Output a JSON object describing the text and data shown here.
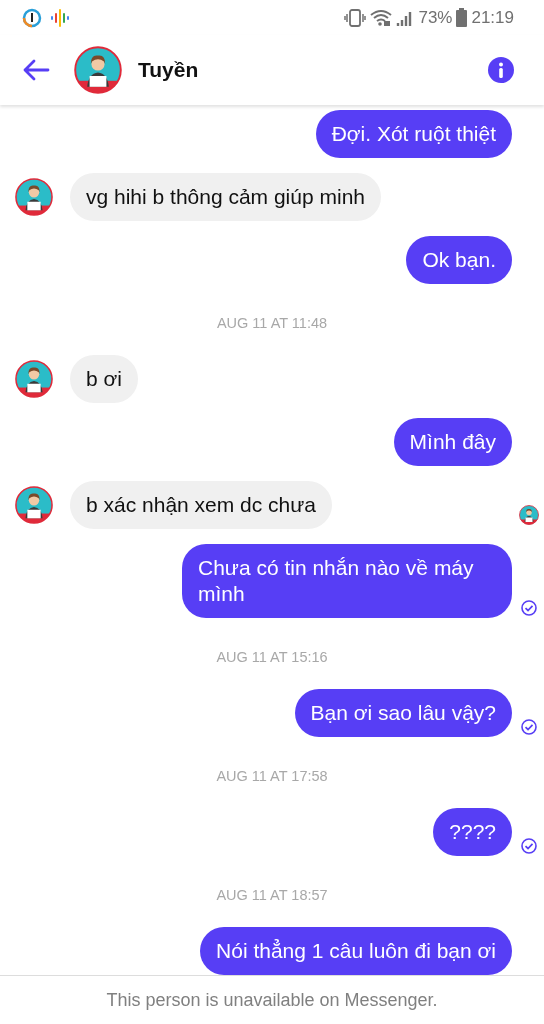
{
  "status_bar": {
    "battery": "73%",
    "time": "21:19"
  },
  "header": {
    "name": "Tuyền"
  },
  "messages": [
    {
      "kind": "outgoing",
      "text": "Đợi. Xót ruột thiệt",
      "sent_check": false
    },
    {
      "kind": "incoming",
      "text": "vg hihi b thông cảm giúp minh",
      "read_marker": false
    },
    {
      "kind": "outgoing",
      "text": "Ok bạn.",
      "sent_check": false
    },
    {
      "kind": "time",
      "text": "AUG 11 AT 11:48"
    },
    {
      "kind": "incoming",
      "text": "b ơi",
      "read_marker": false
    },
    {
      "kind": "outgoing",
      "text": "Mình đây",
      "sent_check": false
    },
    {
      "kind": "incoming",
      "text": "b xác nhận xem dc chưa",
      "read_marker": true
    },
    {
      "kind": "outgoing",
      "text": "Chưa có tin nhắn nào về máy mình",
      "sent_check": true
    },
    {
      "kind": "time",
      "text": "AUG 11 AT 15:16"
    },
    {
      "kind": "outgoing",
      "text": "Bạn ơi sao lâu vậy?",
      "sent_check": true
    },
    {
      "kind": "time",
      "text": "AUG 11 AT 17:58"
    },
    {
      "kind": "outgoing",
      "text": "????",
      "sent_check": true
    },
    {
      "kind": "time",
      "text": "AUG 11 AT 18:57"
    },
    {
      "kind": "outgoing",
      "text": "Nói thẳng 1 câu luôn đi bạn ơi",
      "sent_check": false
    }
  ],
  "footer": {
    "text": "This person is unavailable on Messenger."
  }
}
